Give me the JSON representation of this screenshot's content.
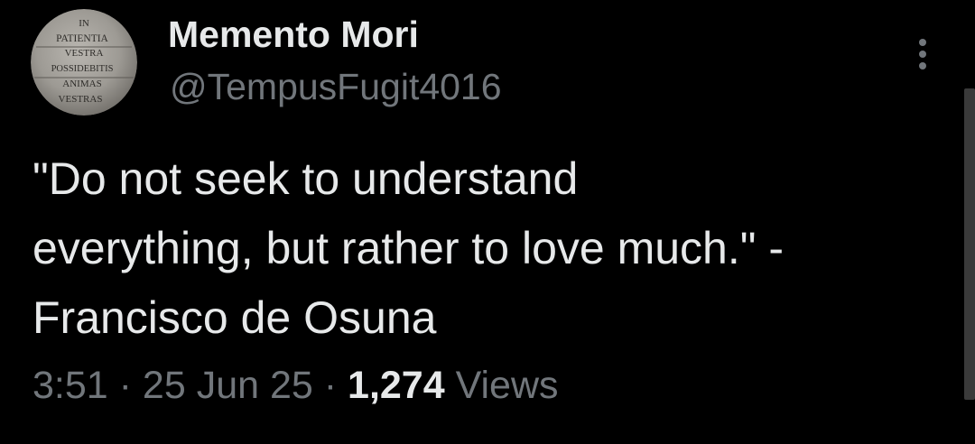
{
  "tweet": {
    "avatar": {
      "icon": "stone-plaque-avatar",
      "lines": [
        "IN",
        "PATIENTIA",
        "VESTRA",
        "POSSIDEBITIS",
        "ANIMAS",
        "VESTRAS"
      ]
    },
    "display_name": "Memento Mori",
    "handle": "@TempusFugit4016",
    "more_icon": "more-vertical-icon",
    "text": "\"Do not seek to understand\neverything, but rather to love much.\" -\nFrancisco de Osuna",
    "time": "3:51",
    "separator": " · ",
    "date": "25 Jun 25",
    "views_count": "1,274",
    "views_label": "Views"
  },
  "colors": {
    "background": "#000000",
    "primary_text": "#e7e9ea",
    "secondary_text": "#71767b",
    "scrollbar": "#3a3a3a"
  }
}
